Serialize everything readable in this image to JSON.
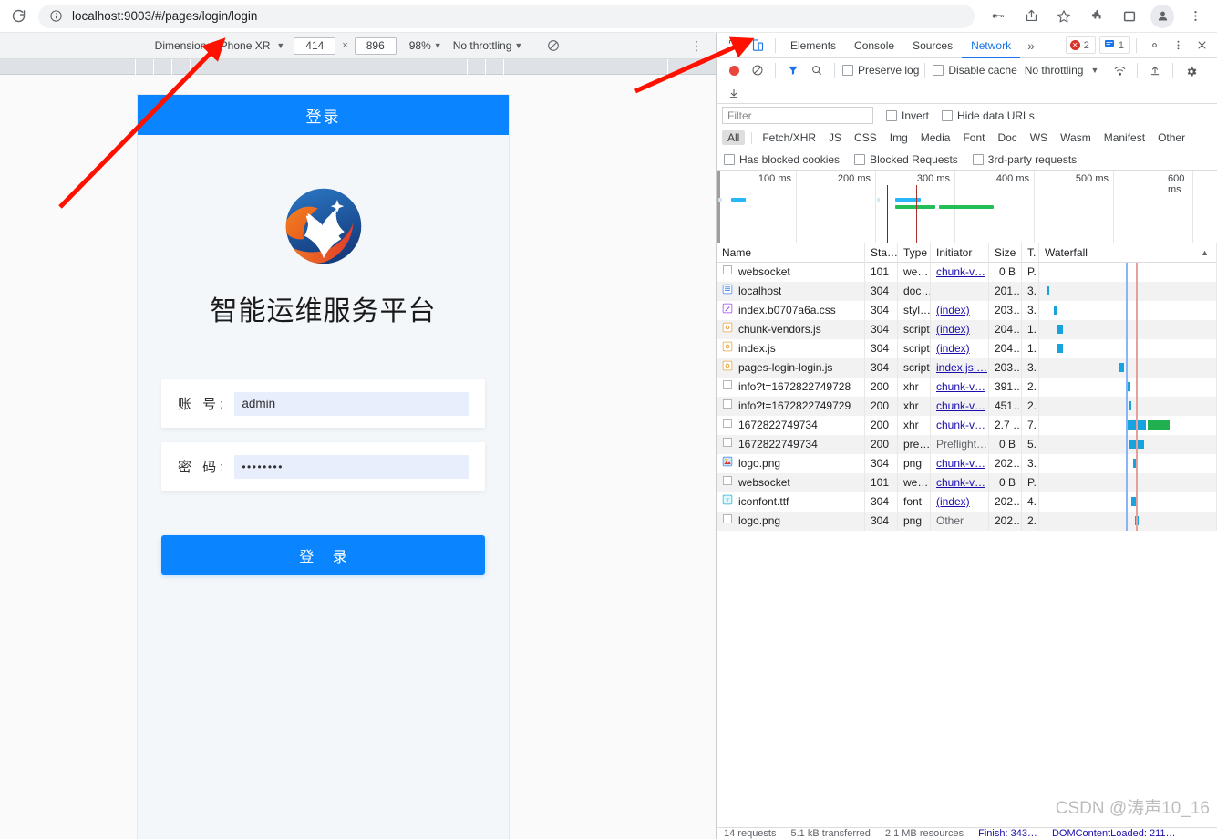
{
  "browser": {
    "url": "localhost:9003/#/pages/login/login",
    "icons": {
      "reload": "reload-icon",
      "info": "info-circle-icon",
      "key": "key-icon",
      "share": "share-icon",
      "star": "star-icon",
      "extensions": "puzzle-piece-icon",
      "sidepanel": "side-panel-icon",
      "profile": "profile-avatar-icon",
      "menu": "three-dot-menu-icon"
    }
  },
  "device_toolbar": {
    "dimensions_label": "Dimensions: iPhone XR",
    "width": "414",
    "height": "896",
    "times": "×",
    "zoom": "98%",
    "throttling": "No throttling",
    "rotate_icon": "rotate-disabled-icon",
    "menu_icon": "three-dot-menu-icon"
  },
  "login_page": {
    "header_title": "登录",
    "brand_title": "智能运维服务平台",
    "logo_icon": "company-bird-logo",
    "account_label": "账 号:",
    "account_value": "admin",
    "password_label": "密 码:",
    "password_value": "••••••••",
    "submit_label": "登 录",
    "accent_color": "#0a84ff",
    "field_bg": "#e8eefc"
  },
  "devtools": {
    "inspect_icon": "inspect-element-icon",
    "device_toggle_icon": "toggle-device-toolbar-icon",
    "tabs": [
      {
        "label": "Elements",
        "selected": false
      },
      {
        "label": "Console",
        "selected": false
      },
      {
        "label": "Sources",
        "selected": false
      },
      {
        "label": "Network",
        "selected": true
      }
    ],
    "more_tabs": "»",
    "error_count": "2",
    "message_count": "1",
    "settings_icon": "gear-icon",
    "dots_icon": "three-dot-menu-icon",
    "close_icon": "close-icon",
    "network_toolbar": {
      "record_icon": "record-stop-icon",
      "clear_icon": "clear-network-icon",
      "filter_icon": "funnel-filter-icon",
      "search_icon": "search-icon",
      "preserve_log": "Preserve log",
      "disable_cache": "Disable cache",
      "throttling": "No throttling",
      "wifi_icon": "network-conditions-icon",
      "import_icon": "upload-har-icon",
      "export_icon": "download-har-icon",
      "settings_icon": "gear-icon"
    },
    "filters": {
      "placeholder": "Filter",
      "invert": "Invert",
      "hide_data_urls": "Hide data URLs",
      "types": [
        "All",
        "Fetch/XHR",
        "JS",
        "CSS",
        "Img",
        "Media",
        "Font",
        "Doc",
        "WS",
        "Wasm",
        "Manifest",
        "Other"
      ],
      "active_type": "All",
      "has_blocked_cookies": "Has blocked cookies",
      "blocked_requests": "Blocked Requests",
      "third_party": "3rd-party requests"
    },
    "overview": {
      "ticks": [
        "100 ms",
        "200 ms",
        "300 ms",
        "400 ms",
        "500 ms",
        "600 ms"
      ]
    },
    "table": {
      "columns": [
        "Name",
        "Sta…",
        "Type",
        "Initiator",
        "Size",
        "T.",
        "Waterfall"
      ],
      "sort_icon": "sort-ascending-icon",
      "rows": [
        {
          "icon": "blank-file-icon",
          "name": "websocket",
          "status": "101",
          "type": "we…",
          "initiator": "chunk-v…",
          "initiator_link": true,
          "size": "0 B",
          "time": "P."
        },
        {
          "icon": "document-icon",
          "name": "localhost",
          "status": "304",
          "type": "doc…",
          "initiator": "",
          "initiator_link": false,
          "size": "201…",
          "time": "3."
        },
        {
          "icon": "stylesheet-icon",
          "name": "index.b0707a6a.css",
          "status": "304",
          "type": "styl…",
          "initiator": "(index)",
          "initiator_link": true,
          "size": "203…",
          "time": "3."
        },
        {
          "icon": "script-icon",
          "name": "chunk-vendors.js",
          "status": "304",
          "type": "script",
          "initiator": "(index)",
          "initiator_link": true,
          "size": "204…",
          "time": "1."
        },
        {
          "icon": "script-icon",
          "name": "index.js",
          "status": "304",
          "type": "script",
          "initiator": "(index)",
          "initiator_link": true,
          "size": "204…",
          "time": "1."
        },
        {
          "icon": "script-icon",
          "name": "pages-login-login.js",
          "status": "304",
          "type": "script",
          "initiator": "index.js:…",
          "initiator_link": true,
          "size": "203…",
          "time": "3."
        },
        {
          "icon": "blank-file-icon",
          "name": "info?t=1672822749728",
          "status": "200",
          "type": "xhr",
          "initiator": "chunk-v…",
          "initiator_link": true,
          "size": "391…",
          "time": "2."
        },
        {
          "icon": "blank-file-icon",
          "name": "info?t=1672822749729",
          "status": "200",
          "type": "xhr",
          "initiator": "chunk-v…",
          "initiator_link": true,
          "size": "451…",
          "time": "2."
        },
        {
          "icon": "blank-file-icon",
          "name": "1672822749734",
          "status": "200",
          "type": "xhr",
          "initiator": "chunk-v…",
          "initiator_link": true,
          "size": "2.7 …",
          "time": "7."
        },
        {
          "icon": "blank-file-icon",
          "name": "1672822749734",
          "status": "200",
          "type": "pre…",
          "initiator": "Preflight…",
          "initiator_link": false,
          "size": "0 B",
          "time": "5."
        },
        {
          "icon": "image-icon",
          "name": "logo.png",
          "status": "304",
          "type": "png",
          "initiator": "chunk-v…",
          "initiator_link": true,
          "size": "202…",
          "time": "3."
        },
        {
          "icon": "blank-file-icon",
          "name": "websocket",
          "status": "101",
          "type": "we…",
          "initiator": "chunk-v…",
          "initiator_link": true,
          "size": "0 B",
          "time": "P."
        },
        {
          "icon": "font-icon",
          "name": "iconfont.ttf",
          "status": "304",
          "type": "font",
          "initiator": "(index)",
          "initiator_link": true,
          "size": "202…",
          "time": "4."
        },
        {
          "icon": "blank-file-icon",
          "name": "logo.png",
          "status": "304",
          "type": "png",
          "initiator": "Other",
          "initiator_link": false,
          "size": "202…",
          "time": "2."
        }
      ]
    },
    "status_bar": {
      "requests": "14 requests",
      "transferred": "5.1 kB transferred",
      "resources": "2.1 MB resources",
      "finish": "Finish: 343…",
      "domcontent": "DOMContentLoaded: 211…"
    }
  },
  "watermark": "CSDN @涛声10_16"
}
